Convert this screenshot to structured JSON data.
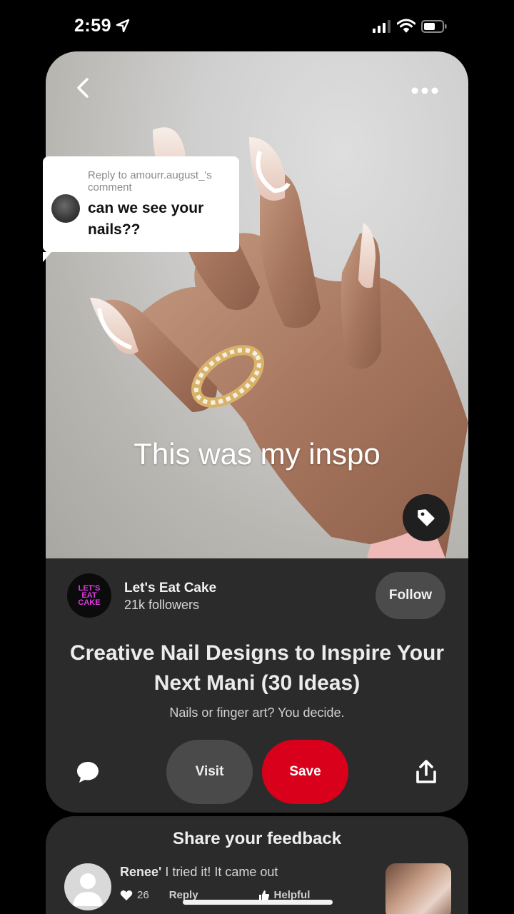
{
  "status_bar": {
    "time": "2:59"
  },
  "pin": {
    "overlay_caption": "This was my inspo",
    "reply": {
      "meta": "Reply to amourr.august_'s comment",
      "text": "can we see your nails??"
    },
    "creator": {
      "avatar_text": "LET'S EAT CAKE",
      "name": "Let's Eat Cake",
      "followers": "21k followers"
    },
    "follow_label": "Follow",
    "title": "Creative Nail Designs to Inspire Your Next Mani (30 Ideas)",
    "description": "Nails or finger art? You decide.",
    "visit_label": "Visit",
    "save_label": "Save",
    "icons": [
      "back-icon",
      "more-icon",
      "tag-icon",
      "comment-icon",
      "share-icon"
    ]
  },
  "feedback": {
    "title": "Share your feedback",
    "comment": {
      "author": "Renee'",
      "text": " I tried it! It came out",
      "likes": "26",
      "reply_label": "Reply",
      "helpful_label": "Helpful"
    }
  },
  "colors": {
    "save": "#d9001b",
    "card": "#2b2b2b",
    "button_gray": "#4a4a4a"
  }
}
